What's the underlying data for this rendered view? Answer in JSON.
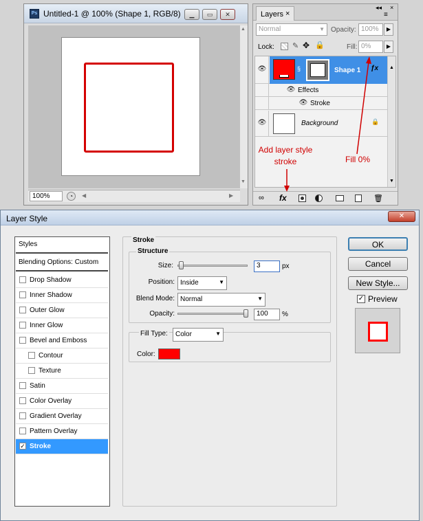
{
  "document_window": {
    "title": "Untitled-1 @ 100% (Shape 1, RGB/8)",
    "app_badge": "Ps",
    "zoom": "100%",
    "shape_color": "#d40000"
  },
  "layers_panel": {
    "tab_label": "Layers",
    "tab_close": "×",
    "blend_mode": "Normal",
    "opacity_label": "Opacity:",
    "opacity_value": "100%",
    "lock_label": "Lock:",
    "fill_label": "Fill:",
    "fill_value": "0%",
    "layers": [
      {
        "name": "Shape 1",
        "selected": true,
        "thumb_color": "#ff0000"
      },
      {
        "name": "Background",
        "selected": false,
        "locked": true
      }
    ],
    "effects_label": "Effects",
    "stroke_effect_label": "Stroke",
    "fx_label": "fx"
  },
  "annotations": {
    "add_stroke_line1": "Add layer style",
    "add_stroke_line2": "stroke",
    "fill_note": "Fill 0%",
    "color": "#d00000"
  },
  "dialog": {
    "title": "Layer Style",
    "close_glyph": "✕",
    "styles_header": "Styles",
    "blending_options": "Blending Options: Custom",
    "styles_list": [
      {
        "label": "Drop Shadow",
        "checked": false,
        "indent": false
      },
      {
        "label": "Inner Shadow",
        "checked": false,
        "indent": false
      },
      {
        "label": "Outer Glow",
        "checked": false,
        "indent": false
      },
      {
        "label": "Inner Glow",
        "checked": false,
        "indent": false
      },
      {
        "label": "Bevel and Emboss",
        "checked": false,
        "indent": false
      },
      {
        "label": "Contour",
        "checked": false,
        "indent": true
      },
      {
        "label": "Texture",
        "checked": false,
        "indent": true
      },
      {
        "label": "Satin",
        "checked": false,
        "indent": false
      },
      {
        "label": "Color Overlay",
        "checked": false,
        "indent": false
      },
      {
        "label": "Gradient Overlay",
        "checked": false,
        "indent": false
      },
      {
        "label": "Pattern Overlay",
        "checked": false,
        "indent": false
      },
      {
        "label": "Stroke",
        "checked": true,
        "indent": false,
        "selected": true
      }
    ],
    "section_title": "Stroke",
    "structure_label": "Structure",
    "size_label": "Size:",
    "size_value": "3",
    "size_unit": "px",
    "position_label": "Position:",
    "position_value": "Inside",
    "blend_mode_label": "Blend Mode:",
    "blend_mode_value": "Normal",
    "opacity_label": "Opacity:",
    "opacity_value": "100",
    "opacity_unit": "%",
    "fill_type_label": "Fill Type:",
    "fill_type_value": "Color",
    "color_label": "Color:",
    "stroke_color": "#ff0000",
    "ok_label": "OK",
    "cancel_label": "Cancel",
    "new_style_label": "New Style...",
    "preview_label": "Preview",
    "preview_checked": true
  }
}
